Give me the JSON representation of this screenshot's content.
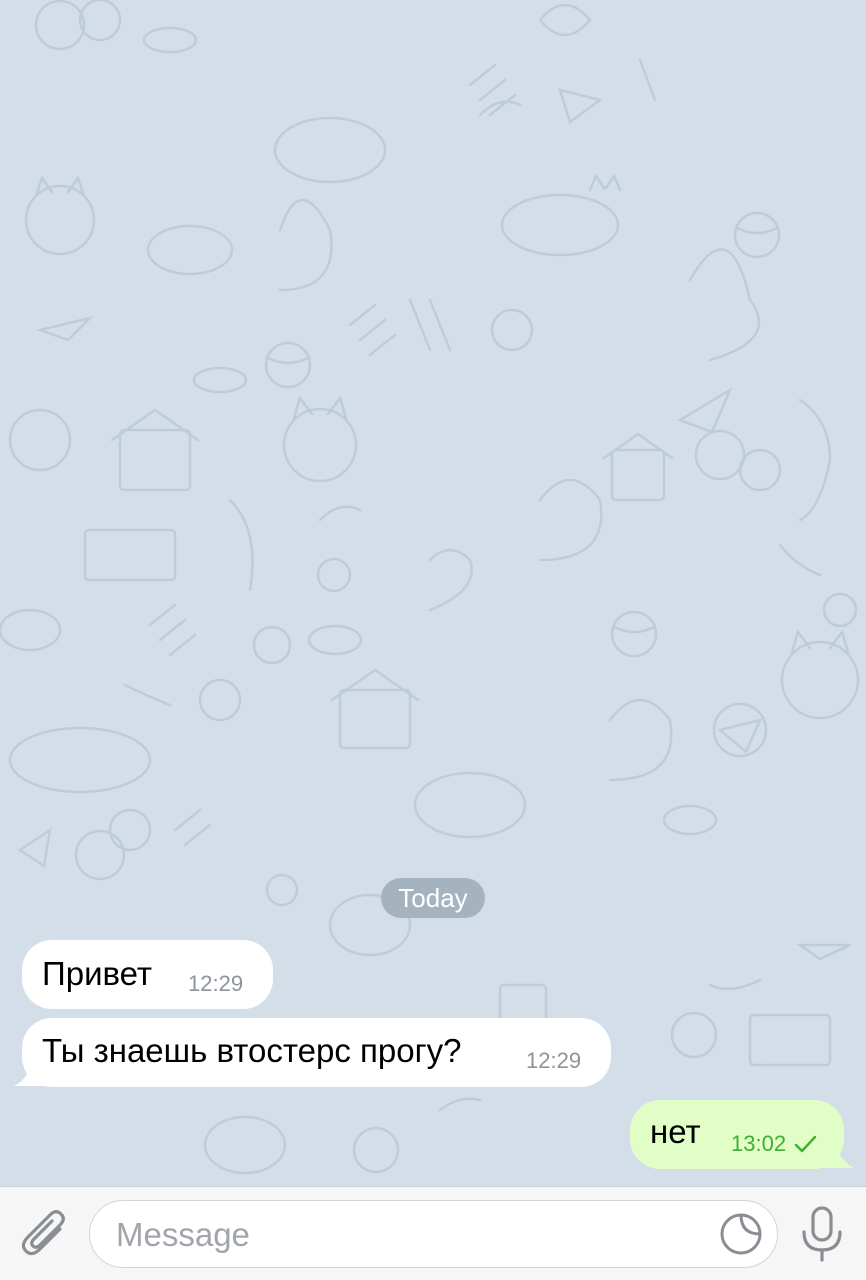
{
  "chat": {
    "date_divider": "Today",
    "messages": [
      {
        "direction": "incoming",
        "text": "Привет",
        "time": "12:29"
      },
      {
        "direction": "incoming",
        "text": "Ты знаешь втостерс прогу?",
        "time": "12:29"
      },
      {
        "direction": "outgoing",
        "text": "нет",
        "time": "13:02",
        "status": "read-check"
      }
    ]
  },
  "composer": {
    "placeholder": "Message",
    "icons": {
      "attach": "paperclip-icon",
      "sticker": "sticker-icon",
      "voice": "microphone-icon"
    }
  },
  "colors": {
    "chat_background": "#d3dee9",
    "incoming_bubble": "#ffffff",
    "outgoing_bubble": "#e1fec6",
    "outgoing_time": "#3fae31",
    "date_pill": "#a5b3bf",
    "input_bar": "#f6f6f7"
  }
}
